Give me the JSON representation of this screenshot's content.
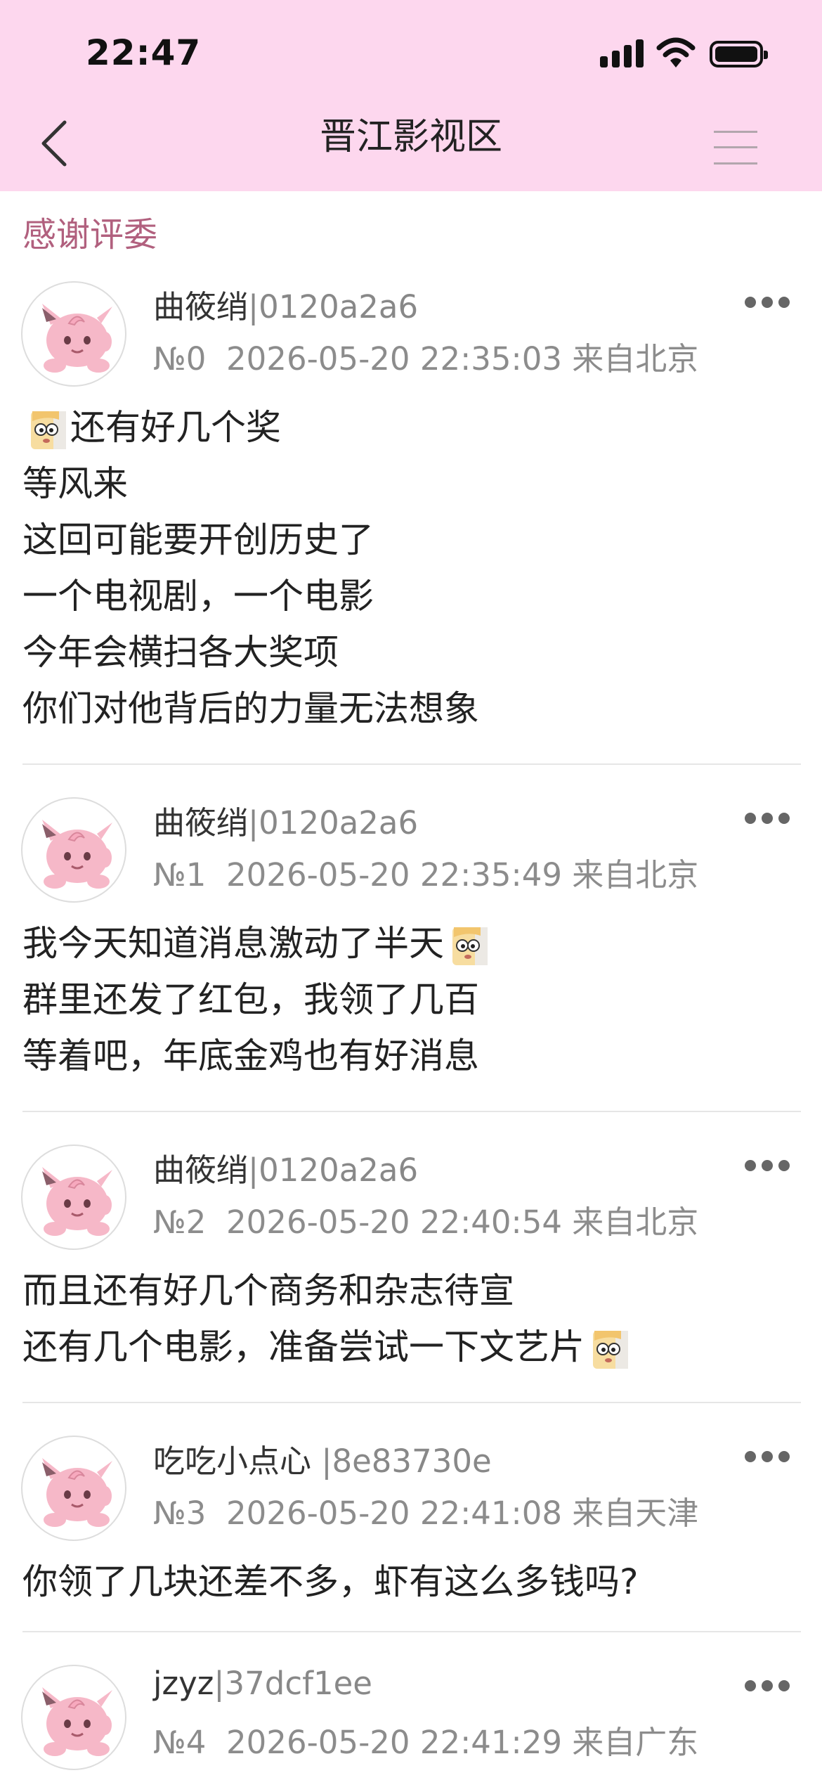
{
  "status_bar": {
    "time": "22:47"
  },
  "nav": {
    "title": "晋江影视区"
  },
  "section": {
    "title": "感谢评委"
  },
  "icons": {
    "back": "chevron-left-icon",
    "menu": "hamburger-icon",
    "more": "more-dots-icon",
    "emoji": "peeking-face-sticker-icon",
    "avatar": "pink-cartoon-avatar"
  },
  "colors": {
    "header_bg": "#fdd7ee",
    "section_title": "#b1607e",
    "meta_text": "#8c8c8c"
  },
  "posts": [
    {
      "author": "曲筱绡",
      "uid": "|0120a2a6",
      "floor": "№0",
      "timestamp": "2026-05-20 22:35:03",
      "location": "来自北京",
      "lines": [
        "还有好几个奖",
        "等风来",
        "这回可能要开创历史了",
        "一个电视剧，一个电影",
        "今年会横扫各大奖项",
        "你们对他背后的力量无法想象"
      ]
    },
    {
      "author": "曲筱绡",
      "uid": "|0120a2a6",
      "floor": "№1",
      "timestamp": "2026-05-20 22:35:49",
      "location": "来自北京",
      "lines": [
        "我今天知道消息激动了半天",
        "群里还发了红包，我领了几百",
        "等着吧，年底金鸡也有好消息"
      ]
    },
    {
      "author": "曲筱绡",
      "uid": "|0120a2a6",
      "floor": "№2",
      "timestamp": "2026-05-20 22:40:54",
      "location": "来自北京",
      "lines": [
        "而且还有好几个商务和杂志待宣",
        "还有几个电影，准备尝试一下文艺片"
      ]
    },
    {
      "author": "吃吃小点心",
      "uid": " |8e83730e",
      "floor": "№3",
      "timestamp": "2026-05-20 22:41:08",
      "location": "来自天津",
      "lines": [
        "你领了几块还差不多，虾有这么多钱吗?"
      ]
    },
    {
      "author": "jzyz",
      "uid": "|37dcf1ee",
      "floor": "№4",
      "timestamp": "2026-05-20 22:41:29",
      "location": "来自广东",
      "lines": []
    }
  ]
}
